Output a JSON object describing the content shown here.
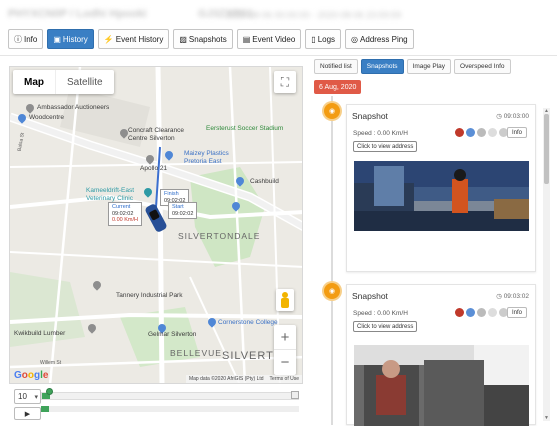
{
  "header": {
    "vehicle": "PHYXCN0P / Lodhi Hpooki",
    "id": "GJ3ZXR01",
    "period": "2020-08-06 00:00:00 - 2020-08-06 23:59:59"
  },
  "tabs": [
    {
      "label": "Info",
      "icon": "info-icon"
    },
    {
      "label": "History",
      "icon": "bus-icon"
    },
    {
      "label": "Event History",
      "icon": "bolt-icon"
    },
    {
      "label": "Snapshots",
      "icon": "image-icon"
    },
    {
      "label": "Event Video",
      "icon": "film-icon"
    },
    {
      "label": "Logs",
      "icon": "file-icon"
    },
    {
      "label": "Address Ping",
      "icon": "target-icon"
    }
  ],
  "map": {
    "type_map": "Map",
    "type_satellite": "Satellite",
    "labels": {
      "ambassador": "Ambassador Auctioneers",
      "woodcentre": "Woodcentre",
      "concraft": "Concraft Clearance",
      "concraft2": "Centre Silverton",
      "eersterust": "Eersterust Soccer Stadium",
      "maizey": "Maizey Plastics",
      "maizey2": "Pretoria East",
      "apollo": "Apollo 21",
      "cashbuild": "Cashbuild",
      "kameeldrift": "Kameeldrift-East",
      "kameeldrift2": "Veterinary Clinic",
      "silvertondale": "SILVERTONDALE",
      "tannery": "Tannery Industrial Park",
      "kwikbuild": "Kwikbuild Lumber",
      "cornerstone": "Cornerstone College",
      "gelmar": "Gelmar Silverton",
      "bellevue": "BELLEVUE",
      "silverton": "SILVERT",
      "balsa": "Balsa St",
      "willem": "Willem St"
    },
    "popup_current": {
      "title": "Current",
      "time": "09:02:02",
      "speed": "0.00 Km/H"
    },
    "popup_finish": {
      "title": "Finish",
      "time": "09:02:02"
    },
    "popup_start": {
      "title": "Start",
      "time": "09:02:02"
    },
    "attribution": "Map data ©2020 AfriGIS (Pty) Ltd",
    "terms": "Terms of Use",
    "google": [
      "G",
      "o",
      "o",
      "g",
      "l",
      "e"
    ]
  },
  "playback": {
    "speed": "10",
    "play": "▶",
    "progress": 0.03
  },
  "right": {
    "tabs": [
      "Notified list",
      "Snapshots",
      "Image Play",
      "Overspeed Info"
    ],
    "active_tab": 1,
    "date": "6 Aug, 2020",
    "cards": [
      {
        "title": "Snapshot",
        "time": "09:03:00",
        "speed": "Speed : 0.00 Km/H",
        "address_btn": "Click to view address",
        "info_btn": "Info"
      },
      {
        "title": "Snapshot",
        "time": "09:03:02",
        "speed": "Speed : 0.00 Km/H",
        "address_btn": "Click to view address",
        "info_btn": "Info"
      }
    ]
  },
  "colors": {
    "accent": "#3a7fc4",
    "date_badge": "#e05a47",
    "timeline_dot": "#f39c12",
    "progress": "#3fa35a"
  }
}
